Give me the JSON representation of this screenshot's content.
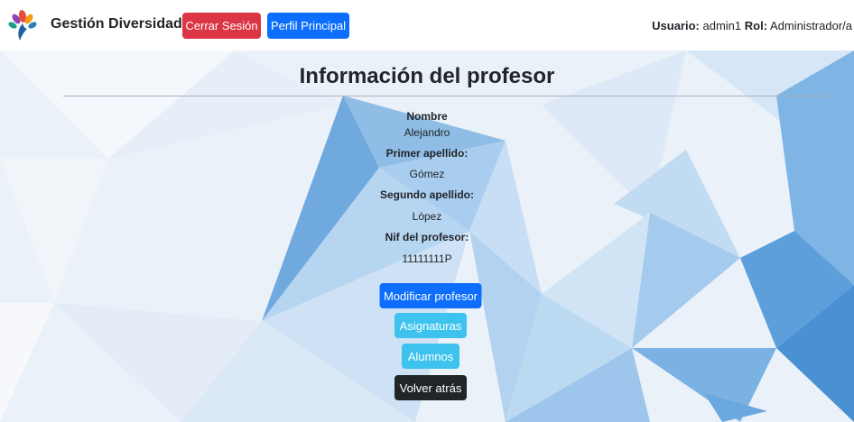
{
  "navbar": {
    "brand": "Gestión Diversidad",
    "logout_label": "Cerrar Sesión",
    "profile_label": "Perfil Principal",
    "user_label": "Usuario:",
    "user_value": "admin1",
    "role_label": "Rol:",
    "role_value": "Administrador/a"
  },
  "page": {
    "title": "Información del profesor"
  },
  "teacher": {
    "name_label": "Nombre",
    "name_value": "Alejandro",
    "surname1_label": "Primer apellido:",
    "surname1_value": "Gómez",
    "surname2_label": "Segundo apellido:",
    "surname2_value": "Lòpez",
    "nif_label": "Nif del profesor:",
    "nif_value": "11111111P"
  },
  "actions": {
    "modify_label": "Modificar profesor",
    "subjects_label": "Asignaturas",
    "students_label": "Alumnos",
    "back_label": "Volver atrás"
  },
  "colors": {
    "danger": "#dc3545",
    "primary": "#0d6efd",
    "info": "#3dc3ee",
    "dark": "#212529"
  }
}
